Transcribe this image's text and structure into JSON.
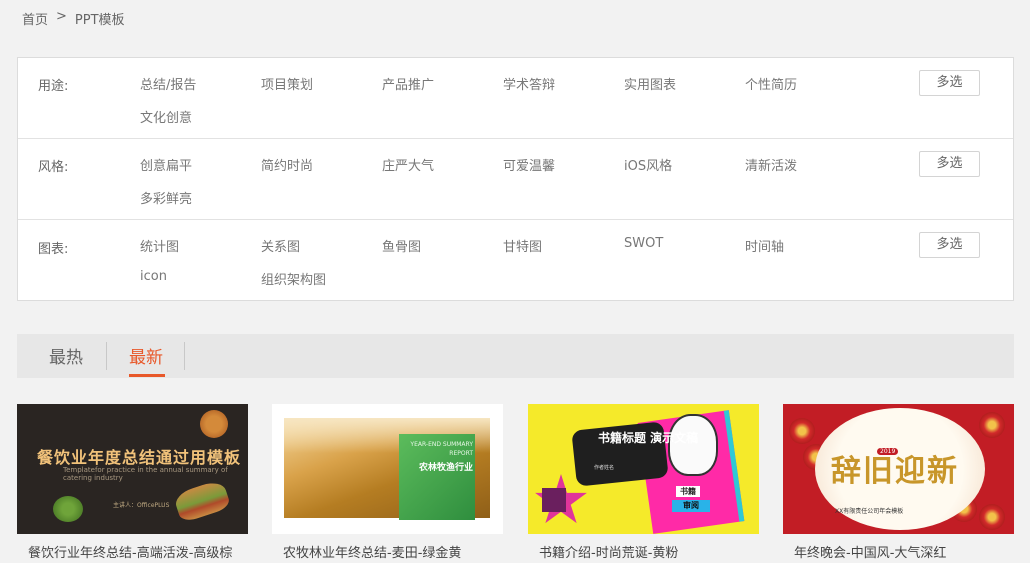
{
  "breadcrumb": {
    "home": "首页",
    "separator": ">",
    "current": "PPT模板"
  },
  "filters": [
    {
      "label": "用途:",
      "options": [
        "总结/报告",
        "项目策划",
        "产品推广",
        "学术答辩",
        "实用图表",
        "个性简历",
        "文化创意"
      ],
      "multi": "多选"
    },
    {
      "label": "风格:",
      "options": [
        "创意扁平",
        "简约时尚",
        "庄严大气",
        "可爱温馨",
        "iOS风格",
        "清新活泼",
        "多彩鲜亮"
      ],
      "multi": "多选"
    },
    {
      "label": "图表:",
      "options": [
        "统计图",
        "关系图",
        "鱼骨图",
        "甘特图",
        "SWOT",
        "时间轴",
        "icon",
        "组织架构图"
      ],
      "multi": "多选"
    }
  ],
  "tabs": [
    {
      "label": "最热",
      "active": false
    },
    {
      "label": "最新",
      "active": true
    }
  ],
  "accent_color": "#e8582a",
  "cards": [
    {
      "title": "餐饮行业年终总结-高端活泼-高级棕",
      "thumb": {
        "headline": "餐饮业年度总结通过用模板",
        "sub": "Templatefor practice in the annual summary of catering industry",
        "author": "主讲人：OfficePLUS"
      }
    },
    {
      "title": "农牧林业年终总结-麦田-绿金黄",
      "thumb": {
        "eng": "YEAR-END SUMMARY REPORT",
        "cn": "农林牧渔行业"
      }
    },
    {
      "title": "书籍介绍-时尚荒诞-黄粉",
      "thumb": {
        "bubble": "书籍标题 演示文稿",
        "author_line": "作者姓名",
        "tag1": "书籍",
        "tag2": "审阅"
      }
    },
    {
      "title": "年终晚会-中国风-大气深红",
      "thumb": {
        "big": "辞旧迎新",
        "year": "2019",
        "small": "XX有限责任公司年会模板"
      }
    }
  ]
}
